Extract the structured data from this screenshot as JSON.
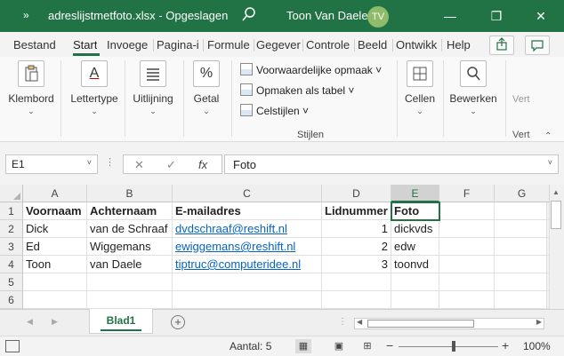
{
  "titlebar": {
    "quick_access": "»",
    "filename": "adreslijstmetfoto.xlsx",
    "separator": "-",
    "saved_status": "Opgeslagen",
    "user_name": "Toon Van Daele",
    "user_initials": "TV",
    "minimize": "—",
    "restore": "❐",
    "close": "✕"
  },
  "tabs": [
    "Bestand",
    "Start",
    "Invoege",
    "Pagina-i",
    "Formule",
    "Gegever",
    "Controle",
    "Beeld",
    "Ontwikk",
    "Help"
  ],
  "active_tab": "Start",
  "ribbon": {
    "klembord": "Klembord",
    "lettertype": "Lettertype",
    "uitlijning": "Uitlijning",
    "getal": "Getal",
    "voorwaardelijke": "Voorwaardelijke opmaak",
    "opmaken_tabel": "Opmaken als tabel",
    "celstijlen": "Celstijlen",
    "stijlen_group": "Stijlen",
    "cellen": "Cellen",
    "bewerken": "Bewerken",
    "vert_faded": "Vert",
    "vert_label": "Vert",
    "caret": "⌄",
    "small_caret": "˅",
    "collapse": "⌃",
    "getal_icon": "%",
    "lettertype_icon": "A"
  },
  "formula_bar": {
    "cell_ref": "E1",
    "dots": "⋮",
    "cancel": "✕",
    "confirm": "✓",
    "fx": "fx",
    "value": "Foto"
  },
  "sheet": {
    "columns": [
      "A",
      "B",
      "C",
      "D",
      "E",
      "F",
      "G"
    ],
    "rows": [
      "1",
      "2",
      "3",
      "4",
      "5",
      "6"
    ],
    "cells": [
      [
        "Voornaam",
        "Achternaam",
        "E-mailadres",
        "Lidnummer",
        "Foto",
        "",
        ""
      ],
      [
        "Dick",
        "van de Schraaf",
        "dvdschraaf@reshift.nl",
        "1",
        "dickvds",
        "",
        ""
      ],
      [
        "Ed",
        "Wiggemans",
        "ewiggemans@reshift.nl",
        "2",
        "edw",
        "",
        ""
      ],
      [
        "Toon",
        "van Daele",
        "tiptruc@computeridee.nl",
        "3",
        "toonvd",
        "",
        ""
      ],
      [
        "",
        "",
        "",
        "",
        "",
        "",
        ""
      ],
      [
        "",
        "",
        "",
        "",
        "",
        "",
        ""
      ]
    ],
    "selected_cell": "E1"
  },
  "sheet_tabs": {
    "active": "Blad1",
    "add": "+",
    "prev": "◀",
    "next": "▶"
  },
  "statusbar": {
    "count_label": "Aantal: 5",
    "zoom_minus": "−",
    "zoom_plus": "+",
    "zoom": "100%",
    "view_normal": "▦",
    "view_layout": "▣",
    "view_break": "⊞"
  },
  "colors": {
    "accent": "#217346",
    "link": "#0563c1"
  }
}
